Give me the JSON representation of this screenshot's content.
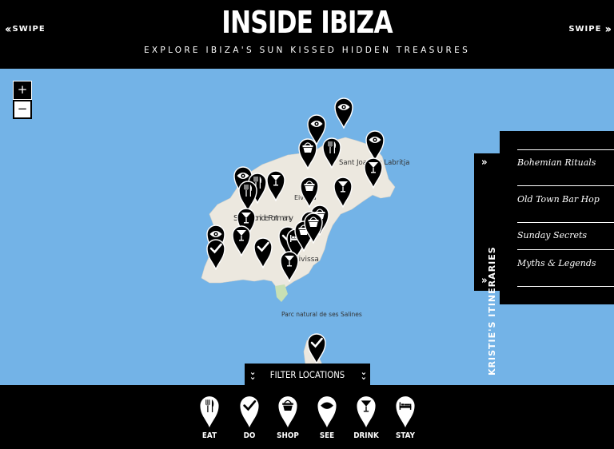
{
  "header": {
    "title": "INSIDE IBIZA",
    "subtitle": "EXPLORE IBIZA'S SUN KISSED HIDDEN TREASURES",
    "swipe_left": "SWIPE",
    "swipe_right": "SWIPE"
  },
  "map": {
    "zoom_in": "+",
    "zoom_out": "−",
    "place_labels": [
      {
        "id": "sant-antoni",
        "text": "Sant Antoni de Portmany"
      },
      {
        "id": "eivissa-top",
        "text": "Eivissa"
      },
      {
        "id": "eivissa",
        "text": "Eivissa"
      },
      {
        "id": "sant-joan",
        "text": "Sant Joan de Labritja"
      },
      {
        "id": "salines",
        "text": "Parc natural de ses Salines"
      }
    ],
    "colors": {
      "sea": "#73b3e7",
      "land": "#ece8df",
      "marker": "#000000"
    },
    "markers": [
      {
        "category": "see"
      },
      {
        "category": "see"
      },
      {
        "category": "shop"
      },
      {
        "category": "eat"
      },
      {
        "category": "see"
      },
      {
        "category": "drink"
      },
      {
        "category": "see"
      },
      {
        "category": "eat"
      },
      {
        "category": "drink"
      },
      {
        "category": "eat"
      },
      {
        "category": "drink"
      },
      {
        "category": "shop"
      },
      {
        "category": "shop"
      },
      {
        "category": "drink"
      },
      {
        "category": "shop"
      },
      {
        "category": "see"
      },
      {
        "category": "do"
      },
      {
        "category": "drink"
      },
      {
        "category": "do"
      },
      {
        "category": "do"
      },
      {
        "category": "stay"
      },
      {
        "category": "shop"
      },
      {
        "category": "shop"
      },
      {
        "category": "drink"
      },
      {
        "category": "do"
      }
    ]
  },
  "itineraries": {
    "tab_label": "KRISTIE'S ITINERARIES",
    "items": [
      {
        "label": "Bohemian Rituals"
      },
      {
        "label": "Old Town Bar Hop"
      },
      {
        "label": "Sunday Secrets"
      },
      {
        "label": "Myths & Legends"
      }
    ]
  },
  "filter": {
    "label": "FILTER LOCATIONS",
    "buttons": [
      {
        "label": "EAT",
        "icon": "cutlery-icon"
      },
      {
        "label": "DO",
        "icon": "checkmark-icon"
      },
      {
        "label": "SHOP",
        "icon": "basket-icon"
      },
      {
        "label": "SEE",
        "icon": "eye-icon"
      },
      {
        "label": "DRINK",
        "icon": "cocktail-icon"
      },
      {
        "label": "STAY",
        "icon": "bed-icon"
      }
    ]
  }
}
